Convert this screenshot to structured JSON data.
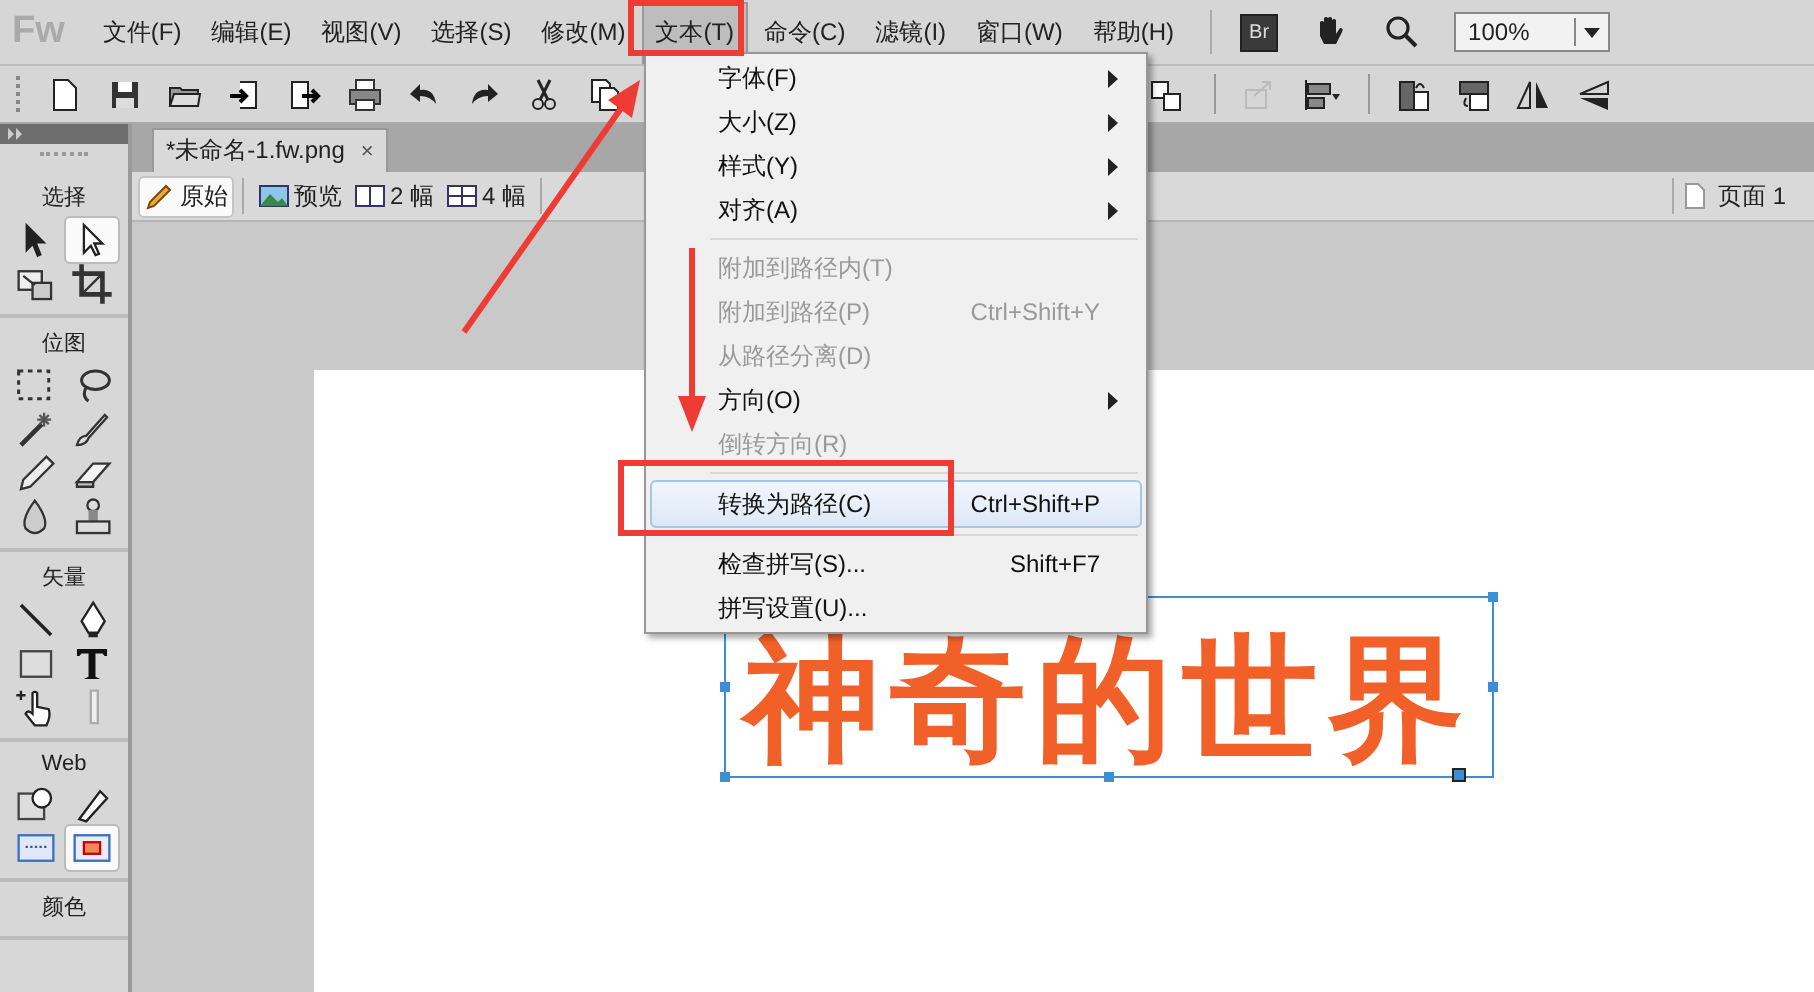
{
  "app": {
    "logo": "Fw"
  },
  "menu_bar": [
    {
      "label": "文件(F)",
      "selected": false
    },
    {
      "label": "编辑(E)",
      "selected": false
    },
    {
      "label": "视图(V)",
      "selected": false
    },
    {
      "label": "选择(S)",
      "selected": false
    },
    {
      "label": "修改(M)",
      "selected": false
    },
    {
      "label": "文本(T)",
      "selected": true
    },
    {
      "label": "命令(C)",
      "selected": false
    },
    {
      "label": "滤镜(I)",
      "selected": false
    },
    {
      "label": "窗口(W)",
      "selected": false
    },
    {
      "label": "帮助(H)",
      "selected": false
    }
  ],
  "bridge_button": "Br",
  "zoom": {
    "value": "100%"
  },
  "document_tab": {
    "title": "*未命名-1.fw.png",
    "close": "×"
  },
  "view_modes": [
    {
      "kind": "original",
      "label": "原始",
      "selected": true
    },
    {
      "kind": "preview",
      "label": "预览",
      "selected": false
    },
    {
      "kind": "two",
      "label": "2 幅",
      "selected": false
    },
    {
      "kind": "four",
      "label": "4 幅",
      "selected": false
    }
  ],
  "page_label": "页面 1",
  "tools_panel": {
    "sections": [
      {
        "title": "选择",
        "tools": [
          {
            "kind": "pointer",
            "selected": false
          },
          {
            "kind": "subselect",
            "selected": true
          },
          {
            "kind": "scale",
            "selected": false
          },
          {
            "kind": "crop",
            "selected": false
          }
        ]
      },
      {
        "title": "位图",
        "tools": [
          {
            "kind": "marquee",
            "selected": false
          },
          {
            "kind": "lasso",
            "selected": false
          },
          {
            "kind": "wand",
            "selected": false
          },
          {
            "kind": "brush",
            "selected": false
          },
          {
            "kind": "pencil",
            "selected": false
          },
          {
            "kind": "eraser",
            "selected": false
          },
          {
            "kind": "blur",
            "selected": false
          },
          {
            "kind": "stamp",
            "selected": false
          }
        ]
      },
      {
        "title": "矢量",
        "tools": [
          {
            "kind": "line",
            "selected": false
          },
          {
            "kind": "pen",
            "selected": false
          },
          {
            "kind": "rectangle",
            "selected": false
          },
          {
            "kind": "text",
            "selected": false
          },
          {
            "kind": "freeform",
            "selected": false
          },
          {
            "kind": "knife",
            "selected": false
          }
        ]
      },
      {
        "title": "Web",
        "tools": [
          {
            "kind": "hotspot",
            "selected": false
          },
          {
            "kind": "slice",
            "selected": false
          },
          {
            "kind": "hide-slices",
            "selected": false
          },
          {
            "kind": "show-slices",
            "selected": true
          }
        ]
      },
      {
        "title": "颜色"
      }
    ]
  },
  "canvas_text": "神奇的世界",
  "text_menu": {
    "items": [
      {
        "kind": "item",
        "label": "字体(F)",
        "submenu": true,
        "disabled": false,
        "selected": false
      },
      {
        "kind": "item",
        "label": "大小(Z)",
        "submenu": true,
        "disabled": false,
        "selected": false
      },
      {
        "kind": "item",
        "label": "样式(Y)",
        "submenu": true,
        "disabled": false,
        "selected": false
      },
      {
        "kind": "item",
        "label": "对齐(A)",
        "submenu": true,
        "disabled": false,
        "selected": false
      },
      {
        "kind": "separator"
      },
      {
        "kind": "item",
        "label": "附加到路径内(T)",
        "submenu": false,
        "disabled": true,
        "selected": false
      },
      {
        "kind": "item",
        "label": "附加到路径(P)",
        "shortcut": "Ctrl+Shift+Y",
        "submenu": false,
        "disabled": true,
        "selected": false
      },
      {
        "kind": "item",
        "label": "从路径分离(D)",
        "submenu": false,
        "disabled": true,
        "selected": false
      },
      {
        "kind": "item",
        "label": "方向(O)",
        "submenu": true,
        "disabled": false,
        "selected": false
      },
      {
        "kind": "item",
        "label": "倒转方向(R)",
        "submenu": false,
        "disabled": true,
        "selected": false
      },
      {
        "kind": "separator"
      },
      {
        "kind": "item",
        "label": "转换为路径(C)",
        "shortcut": "Ctrl+Shift+P",
        "submenu": false,
        "disabled": false,
        "selected": true
      },
      {
        "kind": "separator"
      },
      {
        "kind": "item",
        "label": "检查拼写(S)...",
        "shortcut": "Shift+F7",
        "submenu": false,
        "disabled": false,
        "selected": false
      },
      {
        "kind": "item",
        "label": "拼写设置(U)...",
        "submenu": false,
        "disabled": false,
        "selected": false
      }
    ]
  }
}
